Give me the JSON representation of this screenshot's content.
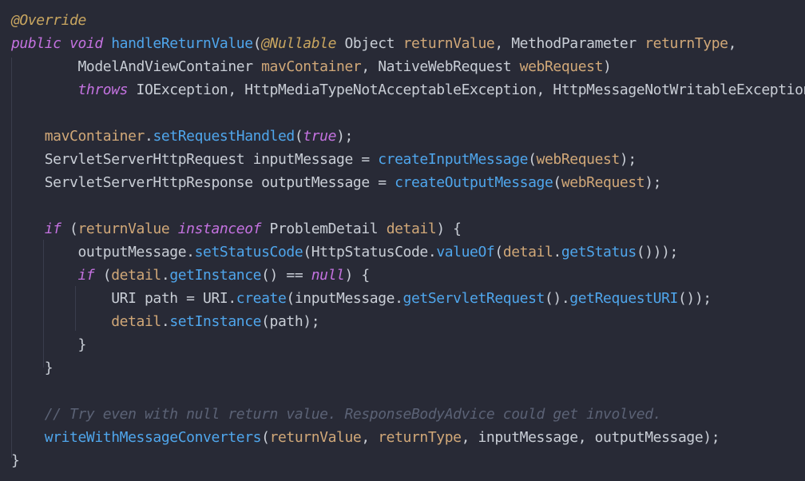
{
  "code": {
    "language": "java",
    "lines": [
      [
        {
          "t": "@Override",
          "c": "ann"
        }
      ],
      [
        {
          "t": "public",
          "c": "kw"
        },
        {
          "t": " ",
          "c": "plain"
        },
        {
          "t": "void",
          "c": "kw"
        },
        {
          "t": " ",
          "c": "plain"
        },
        {
          "t": "handleReturnValue",
          "c": "fn"
        },
        {
          "t": "(",
          "c": "plain"
        },
        {
          "t": "@Nullable",
          "c": "ann"
        },
        {
          "t": " Object ",
          "c": "plain"
        },
        {
          "t": "returnValue",
          "c": "param"
        },
        {
          "t": ", MethodParameter ",
          "c": "plain"
        },
        {
          "t": "returnType",
          "c": "param"
        },
        {
          "t": ",",
          "c": "plain"
        }
      ],
      [
        {
          "t": "        ModelAndViewContainer ",
          "c": "plain"
        },
        {
          "t": "mavContainer",
          "c": "param"
        },
        {
          "t": ", NativeWebRequest ",
          "c": "plain"
        },
        {
          "t": "webRequest",
          "c": "param"
        },
        {
          "t": ")",
          "c": "plain"
        }
      ],
      [
        {
          "t": "        ",
          "c": "plain"
        },
        {
          "t": "throws",
          "c": "kw"
        },
        {
          "t": " IOException, HttpMediaTypeNotAcceptableException, HttpMessageNotWritableException {",
          "c": "plain"
        }
      ],
      [],
      [
        {
          "t": "    ",
          "c": "plain"
        },
        {
          "t": "mavContainer",
          "c": "param"
        },
        {
          "t": ".",
          "c": "plain"
        },
        {
          "t": "setRequestHandled",
          "c": "fn"
        },
        {
          "t": "(",
          "c": "plain"
        },
        {
          "t": "true",
          "c": "kw"
        },
        {
          "t": ");",
          "c": "plain"
        }
      ],
      [
        {
          "t": "    ServletServerHttpRequest inputMessage = ",
          "c": "plain"
        },
        {
          "t": "createInputMessage",
          "c": "fn"
        },
        {
          "t": "(",
          "c": "plain"
        },
        {
          "t": "webRequest",
          "c": "param"
        },
        {
          "t": ");",
          "c": "plain"
        }
      ],
      [
        {
          "t": "    ServletServerHttpResponse outputMessage = ",
          "c": "plain"
        },
        {
          "t": "createOutputMessage",
          "c": "fn"
        },
        {
          "t": "(",
          "c": "plain"
        },
        {
          "t": "webRequest",
          "c": "param"
        },
        {
          "t": ");",
          "c": "plain"
        }
      ],
      [],
      [
        {
          "t": "    ",
          "c": "plain"
        },
        {
          "t": "if",
          "c": "kw"
        },
        {
          "t": " (",
          "c": "plain"
        },
        {
          "t": "returnValue",
          "c": "param"
        },
        {
          "t": " ",
          "c": "plain"
        },
        {
          "t": "instanceof",
          "c": "kw"
        },
        {
          "t": " ProblemDetail ",
          "c": "plain"
        },
        {
          "t": "detail",
          "c": "param"
        },
        {
          "t": ") {",
          "c": "plain"
        }
      ],
      [
        {
          "t": "        outputMessage.",
          "c": "plain"
        },
        {
          "t": "setStatusCode",
          "c": "fn"
        },
        {
          "t": "(HttpStatusCode.",
          "c": "plain"
        },
        {
          "t": "valueOf",
          "c": "fn"
        },
        {
          "t": "(",
          "c": "plain"
        },
        {
          "t": "detail",
          "c": "param"
        },
        {
          "t": ".",
          "c": "plain"
        },
        {
          "t": "getStatus",
          "c": "fn"
        },
        {
          "t": "()));",
          "c": "plain"
        }
      ],
      [
        {
          "t": "        ",
          "c": "plain"
        },
        {
          "t": "if",
          "c": "kw"
        },
        {
          "t": " (",
          "c": "plain"
        },
        {
          "t": "detail",
          "c": "param"
        },
        {
          "t": ".",
          "c": "plain"
        },
        {
          "t": "getInstance",
          "c": "fn"
        },
        {
          "t": "() == ",
          "c": "plain"
        },
        {
          "t": "null",
          "c": "kw"
        },
        {
          "t": ") {",
          "c": "plain"
        }
      ],
      [
        {
          "t": "            URI path = URI.",
          "c": "plain"
        },
        {
          "t": "create",
          "c": "fn"
        },
        {
          "t": "(inputMessage.",
          "c": "plain"
        },
        {
          "t": "getServletRequest",
          "c": "fn"
        },
        {
          "t": "().",
          "c": "plain"
        },
        {
          "t": "getRequestURI",
          "c": "fn"
        },
        {
          "t": "());",
          "c": "plain"
        }
      ],
      [
        {
          "t": "            ",
          "c": "plain"
        },
        {
          "t": "detail",
          "c": "param"
        },
        {
          "t": ".",
          "c": "plain"
        },
        {
          "t": "setInstance",
          "c": "fn"
        },
        {
          "t": "(path);",
          "c": "plain"
        }
      ],
      [
        {
          "t": "        }",
          "c": "plain"
        }
      ],
      [
        {
          "t": "    }",
          "c": "plain"
        }
      ],
      [],
      [
        {
          "t": "    ",
          "c": "plain"
        },
        {
          "t": "// Try even with null return value. ResponseBodyAdvice could get involved.",
          "c": "cmt"
        }
      ],
      [
        {
          "t": "    ",
          "c": "plain"
        },
        {
          "t": "writeWithMessageConverters",
          "c": "fn"
        },
        {
          "t": "(",
          "c": "plain"
        },
        {
          "t": "returnValue",
          "c": "param"
        },
        {
          "t": ", ",
          "c": "plain"
        },
        {
          "t": "returnType",
          "c": "param"
        },
        {
          "t": ", inputMessage, outputMessage);",
          "c": "plain"
        }
      ],
      [
        {
          "t": "}",
          "c": "plain"
        }
      ]
    ]
  },
  "theme": {
    "background": "#282a36",
    "annotation": "#c9a660",
    "keyword": "#c472e0",
    "function": "#4fa6ec",
    "parameter": "#d1a878",
    "text": "#c9ced6",
    "comment": "#5b6275",
    "indent_guide": "#3a3d4c"
  }
}
